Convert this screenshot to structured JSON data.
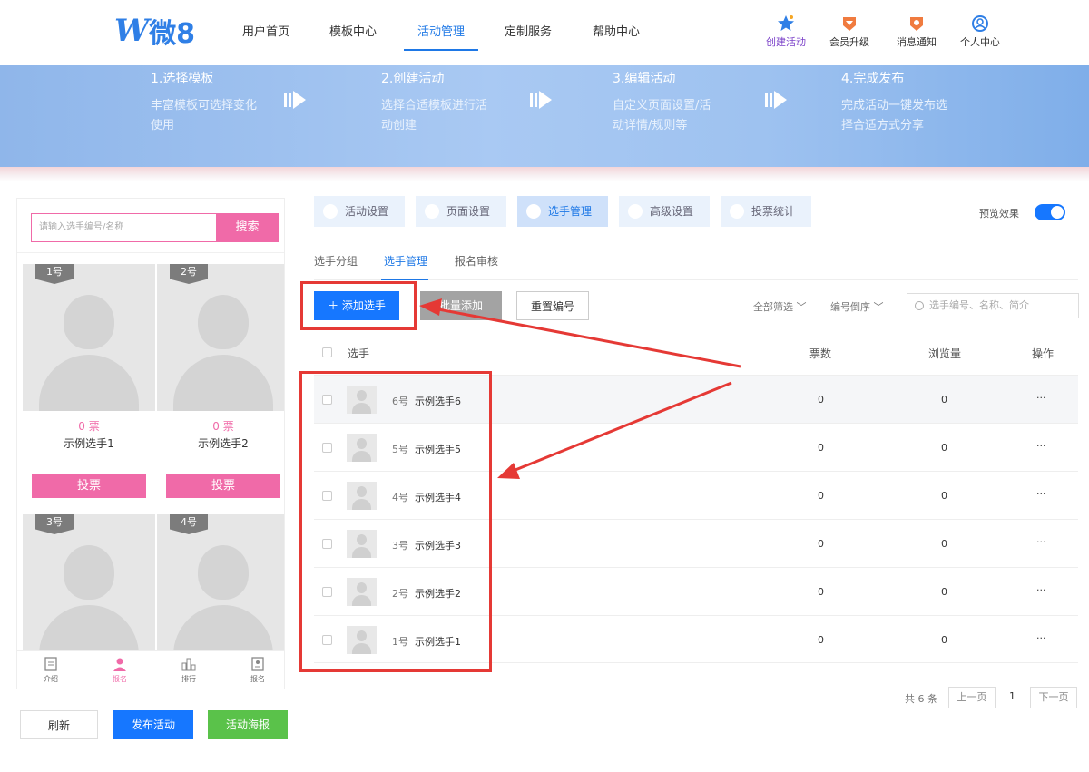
{
  "brand": {
    "logo_w": "W",
    "logo_text": "微8"
  },
  "nav": {
    "items": [
      "用户首页",
      "模板中心",
      "活动管理",
      "定制服务",
      "帮助中心"
    ],
    "active": "活动管理",
    "right": [
      "创建活动",
      "会员升级",
      "消息通知",
      "个人中心"
    ]
  },
  "banner": {
    "steps": [
      {
        "title": "1.选择模板",
        "desc": "丰富模板可选择变化使用"
      },
      {
        "title": "2.创建活动",
        "desc": "选择合适模板进行活动创建"
      },
      {
        "title": "3.编辑活动",
        "desc": "自定义页面设置/活动详情/规则等"
      },
      {
        "title": "4.完成发布",
        "desc": "完成活动一键发布选择合适方式分享"
      }
    ]
  },
  "phone": {
    "search_placeholder": "请输入选手编号/名称",
    "search_button": "搜索",
    "cards": [
      {
        "badge": "1号",
        "votes": "0 票",
        "name": "示例选手1",
        "button": "投票"
      },
      {
        "badge": "2号",
        "votes": "0 票",
        "name": "示例选手2",
        "button": "投票"
      },
      {
        "badge": "3号"
      },
      {
        "badge": "4号"
      }
    ],
    "tabs": [
      "介绍",
      "报名",
      "排行",
      "报名"
    ]
  },
  "actions": {
    "refresh": "刷新",
    "publish": "发布活动",
    "poster": "活动海报"
  },
  "settings": {
    "tabs": [
      "活动设置",
      "页面设置",
      "选手管理",
      "高级设置",
      "投票统计"
    ],
    "active": "选手管理",
    "preview_label": "预览效果",
    "preview_on": true
  },
  "subtabs": {
    "items": [
      "选手分组",
      "选手管理",
      "报名审核"
    ],
    "active": "选手管理"
  },
  "toolbar": {
    "add": "＋ 添加选手",
    "batch": "批量添加",
    "reset": "重置编号",
    "filter_all": "全部筛选",
    "sort": "编号倒序",
    "search_placeholder": "选手编号、名称、简介"
  },
  "table": {
    "headers": {
      "player": "选手",
      "votes": "票数",
      "views": "浏览量",
      "ops": "操作"
    },
    "rows": [
      {
        "num": "6号",
        "name": "示例选手6",
        "votes": "0",
        "views": "0",
        "ops": "···"
      },
      {
        "num": "5号",
        "name": "示例选手5",
        "votes": "0",
        "views": "0",
        "ops": "···"
      },
      {
        "num": "4号",
        "name": "示例选手4",
        "votes": "0",
        "views": "0",
        "ops": "···"
      },
      {
        "num": "3号",
        "name": "示例选手3",
        "votes": "0",
        "views": "0",
        "ops": "···"
      },
      {
        "num": "2号",
        "name": "示例选手2",
        "votes": "0",
        "views": "0",
        "ops": "···"
      },
      {
        "num": "1号",
        "name": "示例选手1",
        "votes": "0",
        "views": "0",
        "ops": "···"
      }
    ]
  },
  "pagination": {
    "total": "共 6 条",
    "prev": "上一页",
    "page": "1",
    "next": "下一页"
  },
  "colors": {
    "primary": "#1677ff",
    "pink": "#f06aa8",
    "green": "#5ac24a",
    "annotation": "#e53935"
  }
}
